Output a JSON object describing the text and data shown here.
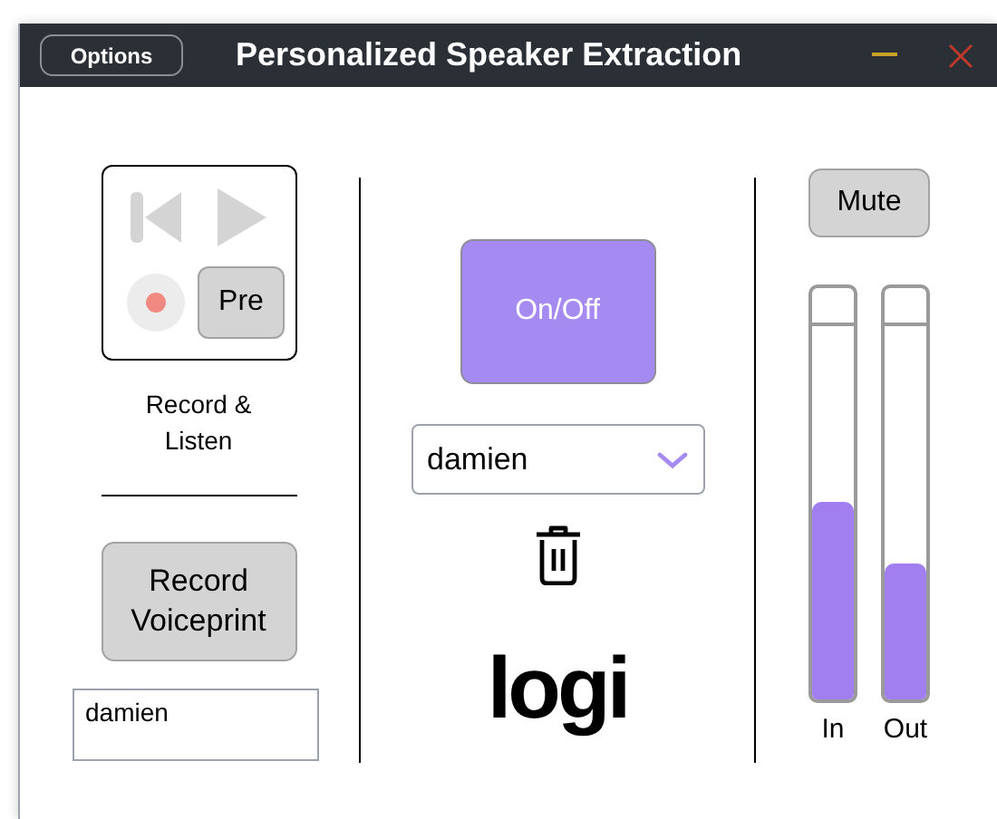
{
  "window": {
    "title": "Personalized Speaker Extraction",
    "options_button": "Options"
  },
  "record_listen": {
    "controls": [
      {
        "kind": "skip-back",
        "disabled": true
      },
      {
        "kind": "play",
        "disabled": true
      },
      {
        "kind": "record",
        "disabled": false
      },
      {
        "kind": "text",
        "label": "Pre",
        "disabled": false
      }
    ],
    "label": "Record & Listen"
  },
  "voiceprint": {
    "button": "Record Voiceprint",
    "name_field": {
      "value": "damien"
    }
  },
  "center": {
    "power_button": "On/Off",
    "speaker_dropdown": {
      "value": "damien"
    },
    "logo": "logi"
  },
  "right": {
    "mute_button": "Mute",
    "meters": [
      {
        "label": "In",
        "level": 0.48
      },
      {
        "label": "Out",
        "level": 0.33
      }
    ]
  }
}
